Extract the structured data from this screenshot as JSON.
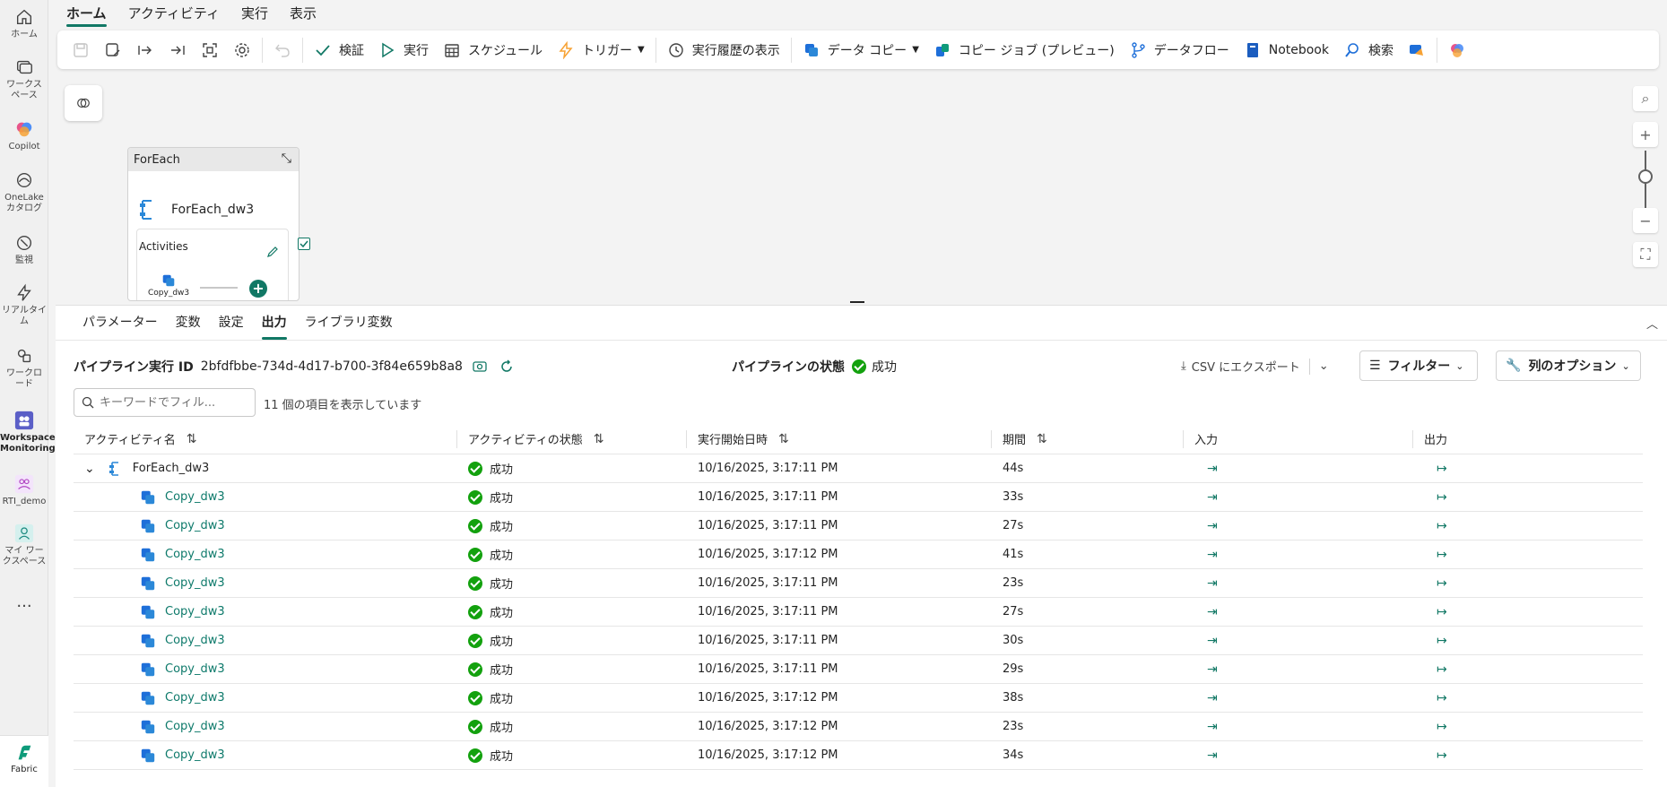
{
  "rail": {
    "items": [
      {
        "label": "ホーム",
        "icon": "home-icon"
      },
      {
        "label": "ワークスペース",
        "icon": "workspaces-icon"
      },
      {
        "label": "Copilot",
        "icon": "copilot-icon"
      },
      {
        "label": "OneLake カタログ",
        "icon": "onelake-icon"
      },
      {
        "label": "監視",
        "icon": "monitor-icon"
      },
      {
        "label": "リアルタイム",
        "icon": "realtime-icon"
      },
      {
        "label": "ワークロード",
        "icon": "workload-icon"
      },
      {
        "label": "Workspace Monitoring",
        "icon": "workspace-monitoring-icon"
      },
      {
        "label": "RTI_demo",
        "icon": "rti-demo-icon"
      },
      {
        "label": "マイ ワークスペース",
        "icon": "my-workspace-icon"
      },
      {
        "label": "...",
        "icon": "more-icon"
      }
    ],
    "fabric_label": "Fabric"
  },
  "top_tabs": [
    "ホーム",
    "アクティビティ",
    "実行",
    "表示"
  ],
  "toolbar": {
    "validate": "検証",
    "run": "実行",
    "schedule": "スケジュール",
    "trigger": "トリガー",
    "run_history": "実行履歴の表示",
    "data_copy": "データ コピー",
    "copy_job": "コピー ジョブ (プレビュー)",
    "dataflow": "データフロー",
    "notebook": "Notebook",
    "search": "検索"
  },
  "canvas": {
    "foreach_title": "ForEach",
    "foreach_name": "ForEach_dw3",
    "activities_label": "Activities",
    "inner_activity": "Copy_dw3"
  },
  "panel": {
    "tabs": [
      "パラメーター",
      "変数",
      "設定",
      "出力",
      "ライブラリ変数"
    ],
    "active_tab": "出力",
    "run_id_label": "パイプライン実行 ID",
    "run_id": "2bfdfbbe-734d-4d17-b700-3f84e659b8a8",
    "status_label": "パイプラインの状態",
    "status_value": "成功",
    "export_label": "CSV にエクスポート",
    "filter_label": "フィルター",
    "column_options_label": "列のオプション",
    "search_placeholder": "キーワードでフィル...",
    "item_count": "11 個の項目を表示しています"
  },
  "table": {
    "headers": [
      "アクティビティ名",
      "アクティビティの状態",
      "実行開始日時",
      "期間",
      "入力",
      "出力"
    ],
    "rows": [
      {
        "name": "ForEach_dw3",
        "status": "成功",
        "start": "10/16/2025, 3:17:11 PM",
        "duration": "44s"
      },
      {
        "name": "Copy_dw3",
        "status": "成功",
        "start": "10/16/2025, 3:17:11 PM",
        "duration": "33s"
      },
      {
        "name": "Copy_dw3",
        "status": "成功",
        "start": "10/16/2025, 3:17:11 PM",
        "duration": "27s"
      },
      {
        "name": "Copy_dw3",
        "status": "成功",
        "start": "10/16/2025, 3:17:12 PM",
        "duration": "41s"
      },
      {
        "name": "Copy_dw3",
        "status": "成功",
        "start": "10/16/2025, 3:17:11 PM",
        "duration": "23s"
      },
      {
        "name": "Copy_dw3",
        "status": "成功",
        "start": "10/16/2025, 3:17:11 PM",
        "duration": "27s"
      },
      {
        "name": "Copy_dw3",
        "status": "成功",
        "start": "10/16/2025, 3:17:11 PM",
        "duration": "30s"
      },
      {
        "name": "Copy_dw3",
        "status": "成功",
        "start": "10/16/2025, 3:17:11 PM",
        "duration": "29s"
      },
      {
        "name": "Copy_dw3",
        "status": "成功",
        "start": "10/16/2025, 3:17:12 PM",
        "duration": "38s"
      },
      {
        "name": "Copy_dw3",
        "status": "成功",
        "start": "10/16/2025, 3:17:12 PM",
        "duration": "23s"
      },
      {
        "name": "Copy_dw3",
        "status": "成功",
        "start": "10/16/2025, 3:17:12 PM",
        "duration": "34s"
      }
    ]
  },
  "colors": {
    "accent": "#117865",
    "success": "#13a10e",
    "link": "#0e7a6b"
  }
}
